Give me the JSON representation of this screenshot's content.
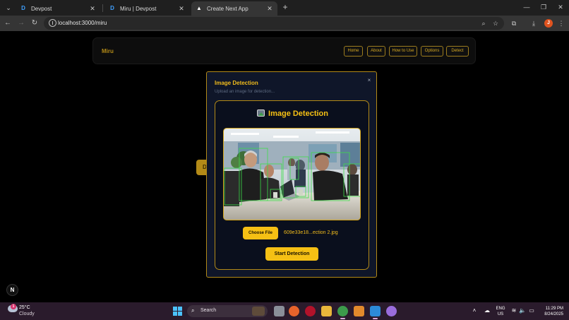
{
  "browser": {
    "tabs": [
      {
        "title": "Devpost",
        "favicon": "D",
        "active": false
      },
      {
        "title": "Miru | Devpost",
        "favicon": "D",
        "active": false
      },
      {
        "title": "Create Next App",
        "favicon": "▲",
        "active": true
      }
    ],
    "url": "localhost:3000/miru"
  },
  "navbar": {
    "brand": "Miru",
    "links": [
      "Home",
      "About",
      "How to Use",
      "Options",
      "Detect"
    ]
  },
  "background_button_label": "D",
  "modal": {
    "title": "Image Detection",
    "subtitle": "Upload an image for detection...",
    "close_label": "×",
    "card_heading": "Image Detection",
    "choose_file_label": "Choose File",
    "file_name": "609e33e18...ection 2.jpg",
    "start_label": "Start Detection"
  },
  "next_badge": "N",
  "taskbar": {
    "weather_temp": "25°C",
    "weather_desc": "Cloudy",
    "weather_badge": "1",
    "search_label": "Search",
    "lang_top": "ENG",
    "lang_bottom": "US",
    "time": "11:29 PM",
    "date": "8/24/2025"
  },
  "colors": {
    "accent": "#f5c014",
    "modal_bg": "#0f1629",
    "border_gold": "#b38a17",
    "detection_box": "#3ddc4a"
  }
}
